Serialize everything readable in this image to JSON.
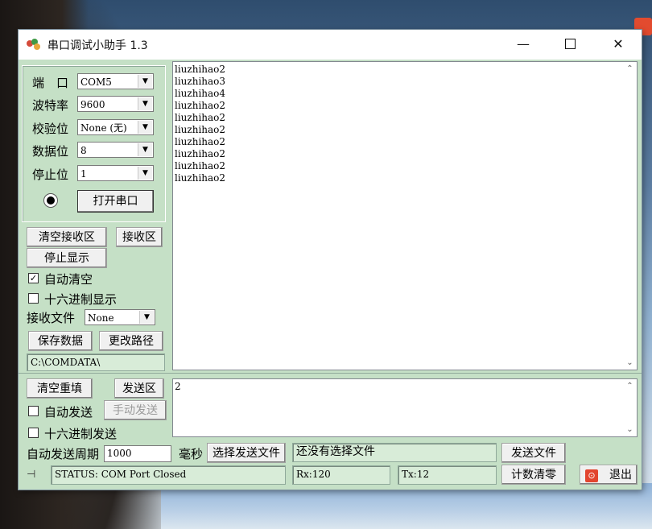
{
  "window": {
    "title": "串口调试小助手 1.3",
    "minimize_glyph": "—",
    "close_glyph": "✕"
  },
  "port_settings": {
    "port_label": "端　口",
    "port_value": "COM5",
    "baud_label": "波特率",
    "baud_value": "9600",
    "parity_label": "校验位",
    "parity_value": "None (无)",
    "databits_label": "数据位",
    "databits_value": "8",
    "stopbits_label": "停止位",
    "stopbits_value": "1",
    "open_button": "打开串口",
    "dropdown_glyph": "▼"
  },
  "receive_controls": {
    "clear_button": "清空接收区",
    "area_button": "接收区",
    "stop_display_button": "停止显示",
    "auto_clear_label": "自动清空",
    "auto_clear_checked": true,
    "hex_display_label": "十六进制显示",
    "hex_display_checked": false,
    "file_label": "接收文件",
    "file_value": "None",
    "save_button": "保存数据",
    "change_path_button": "更改路径",
    "path_value": "C:\\COMDATA\\"
  },
  "receive_area": {
    "lines": [
      "liuzhihao2",
      "liuzhihao3",
      "liuzhihao4",
      "liuzhihao2",
      "liuzhihao2",
      "liuzhihao2",
      "liuzhihao2",
      "liuzhihao2",
      "liuzhihao2",
      "liuzhihao2"
    ]
  },
  "send_controls": {
    "clear_refill_button": "清空重填",
    "send_area_button": "发送区",
    "auto_send_label": "自动发送",
    "auto_send_checked": false,
    "manual_send_button": "手动发送",
    "hex_send_label": "十六进制发送",
    "hex_send_checked": false,
    "period_label": "自动发送周期",
    "period_value": "1000",
    "ms_label": "毫秒",
    "select_file_button": "选择发送文件",
    "file_status": "还没有选择文件",
    "send_file_button": "发送文件",
    "send_text": "2"
  },
  "status_bar": {
    "status_text": "STATUS: COM Port Closed",
    "rx_text": "Rx:120",
    "tx_text": "Tx:12",
    "reset_count_button": "计数清零",
    "exit_button": "退出"
  },
  "icons": {
    "pin": "⊣",
    "stop": "⊙",
    "check": "✓",
    "scroll_up": "⌃",
    "scroll_down": "⌄"
  },
  "colors": {
    "panel_bg": "#c5e0c6",
    "exit_icon": "#e2452f"
  }
}
